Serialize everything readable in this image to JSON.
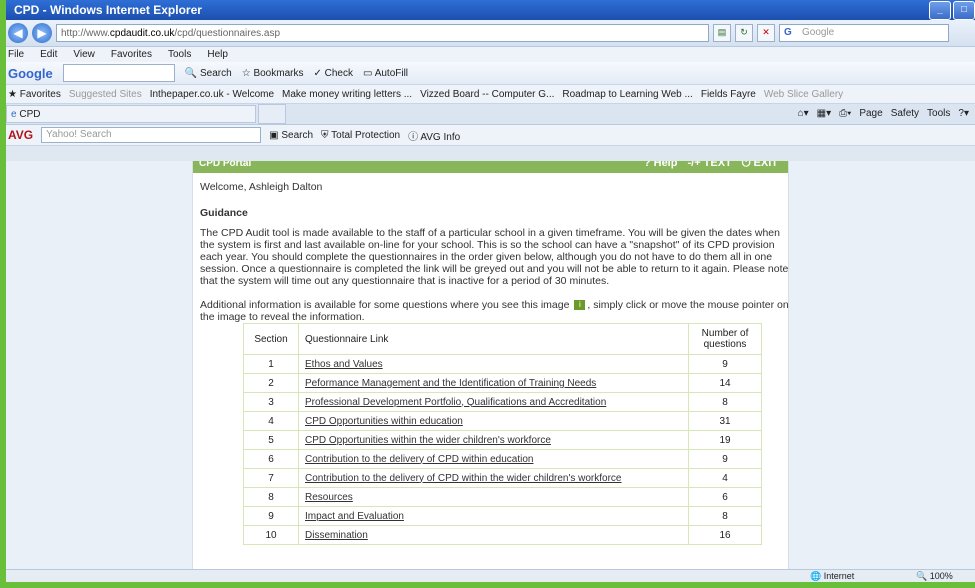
{
  "window": {
    "title": "CPD - Windows Internet Explorer"
  },
  "address": {
    "url_prefix": "http://www.",
    "url_domain": "cpdaudit.co.uk",
    "url_path": "/cpd/questionnaires.asp",
    "search_placeholder": "Google"
  },
  "menu": [
    "File",
    "Edit",
    "View",
    "Favorites",
    "Tools",
    "Help"
  ],
  "google_toolbar": {
    "logo": "Google",
    "search": "Search",
    "bookmarks": "Bookmarks",
    "check": "Check",
    "autofill": "AutoFill"
  },
  "favorites": {
    "label": "Favorites",
    "items": [
      "Suggested Sites",
      "Inthepaper.co.uk - Welcome",
      "Make money writing letters ...",
      "Vizzed Board -- Computer G...",
      "Roadmap to Learning Web ...",
      "Fields Fayre",
      "Web Slice Gallery"
    ]
  },
  "tab": {
    "label": "CPD"
  },
  "command_bar": [
    "Page",
    "Safety",
    "Tools"
  ],
  "avg": {
    "logo": "AVG",
    "yahoo_placeholder": "Yahoo! Search",
    "search": "Search",
    "protection": "Total Protection",
    "info": "AVG Info"
  },
  "portal": {
    "title": "CPD Portal",
    "help": "Help",
    "text_size": "-/+ TEXT",
    "exit": "EXIT"
  },
  "page": {
    "welcome": "Welcome, Ashleigh Dalton",
    "guidance_heading": "Guidance",
    "guidance_text": "The CPD Audit tool is made available to the staff of a particular school in a given timeframe. You will be given the dates when the system is first and last available on-line for your school. This is so the school can have a \"snapshot\" of its CPD provision each year. You should complete the questionnaires in the order given below, although you do not have to do them all in one session. Once a questionnaire is completed the link will be greyed out and you will not be able to return to it again. Please note that the system will time out any questionnaire that is inactive for a period of 30 minutes.",
    "info_before": "Additional information is available for some questions where you see this image",
    "info_after": ", simply click or move the mouse pointer on the image to reveal the information."
  },
  "table": {
    "headers": {
      "section": "Section",
      "link": "Questionnaire Link",
      "count": "Number of questions"
    },
    "rows": [
      {
        "section": "1",
        "link": "Ethos and Values",
        "count": "9"
      },
      {
        "section": "2",
        "link": "Peformance Management and the Identification of Training Needs",
        "count": "14"
      },
      {
        "section": "3",
        "link": "Professional Development Portfolio, Qualifications and Accreditation",
        "count": "8"
      },
      {
        "section": "4",
        "link": "CPD Opportunities within education",
        "count": "31"
      },
      {
        "section": "5",
        "link": "CPD Opportunities within the wider children's workforce",
        "count": "19"
      },
      {
        "section": "6",
        "link": "Contribution to the delivery of CPD within education",
        "count": "9"
      },
      {
        "section": "7",
        "link": "Contribution to the delivery of CPD within the wider children's workforce",
        "count": "4"
      },
      {
        "section": "8",
        "link": "Resources",
        "count": "6"
      },
      {
        "section": "9",
        "link": "Impact and Evaluation",
        "count": "8"
      },
      {
        "section": "10",
        "link": "Dissemination",
        "count": "16"
      }
    ]
  },
  "status": {
    "zone": "Internet",
    "zoom": "100%"
  }
}
